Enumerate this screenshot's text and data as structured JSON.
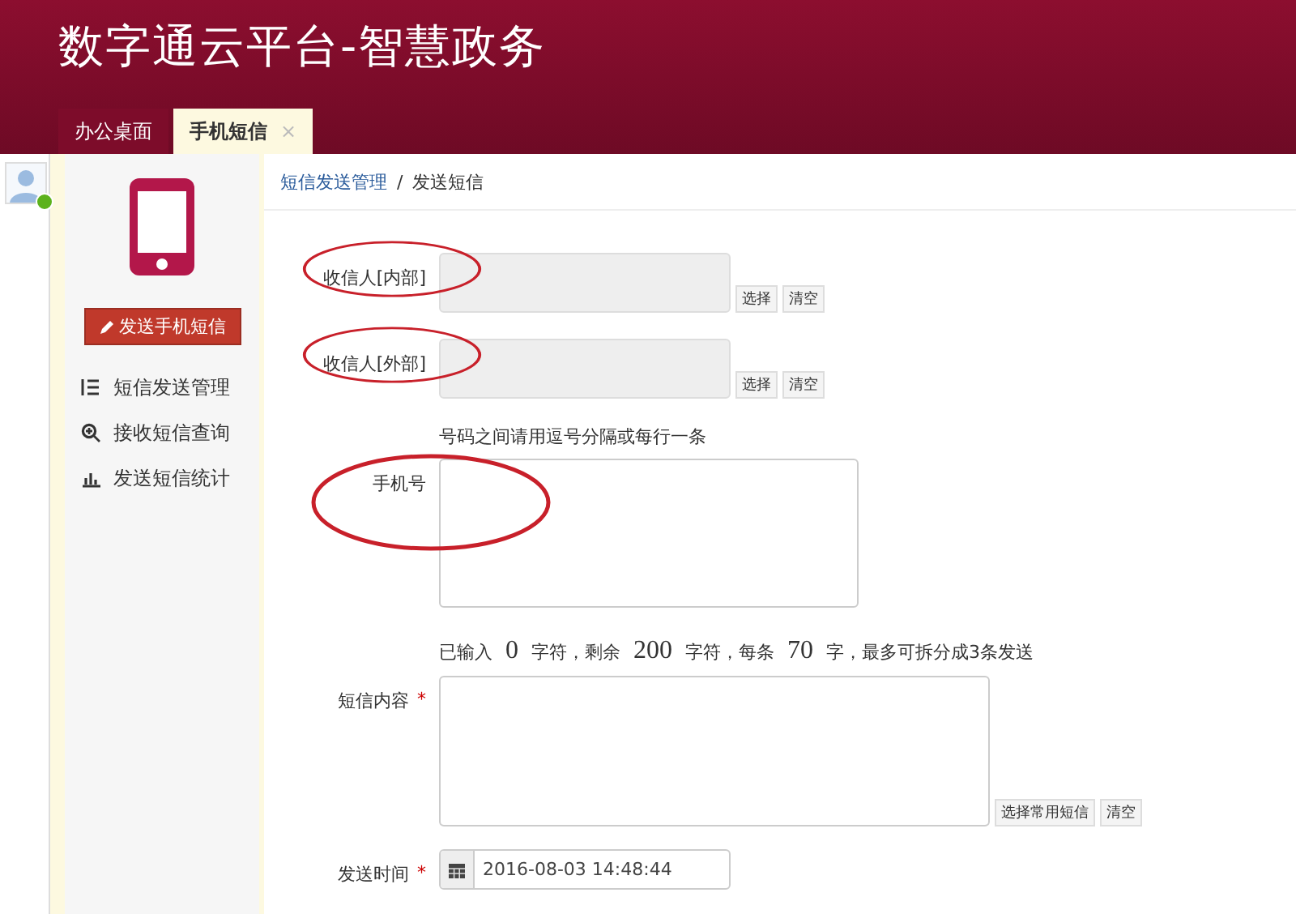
{
  "header": {
    "title": "数字通云平台-智慧政务"
  },
  "tabs": [
    {
      "label": "办公桌面",
      "selected": false
    },
    {
      "label": "手机短信",
      "selected": true,
      "close": "×"
    }
  ],
  "sidebar": {
    "action": "发送手机短信",
    "items": [
      {
        "label": "短信发送管理"
      },
      {
        "label": "接收短信查询"
      },
      {
        "label": "发送短信统计"
      }
    ]
  },
  "breadcrumb": {
    "link": "短信发送管理",
    "separator": "/",
    "current": "发送短信"
  },
  "form": {
    "rows": [
      {
        "kind": "picker",
        "label": "收信人[内部]",
        "circled": true,
        "buttons": [
          "选择",
          "清空"
        ]
      },
      {
        "kind": "picker",
        "label": "收信人[外部]",
        "circled": true,
        "buttons": [
          "选择",
          "清空"
        ]
      },
      {
        "kind": "textarea",
        "label": "手机号",
        "circled": true,
        "hint": "号码之间请用逗号分隔或每行一条"
      },
      {
        "kind": "message",
        "label": "短信内容",
        "required_mark": "*",
        "circled": false,
        "counter": [
          "已输入",
          "0",
          "字符，剩余",
          "200",
          "字符，每条",
          "70",
          "字，最多可拆分成3条发送"
        ],
        "buttons": [
          "选择常用短信",
          "清空"
        ]
      },
      {
        "kind": "date",
        "label": "发送时间",
        "required_mark": "*",
        "circled": false,
        "value": "2016-08-03 14:48:44"
      }
    ]
  }
}
